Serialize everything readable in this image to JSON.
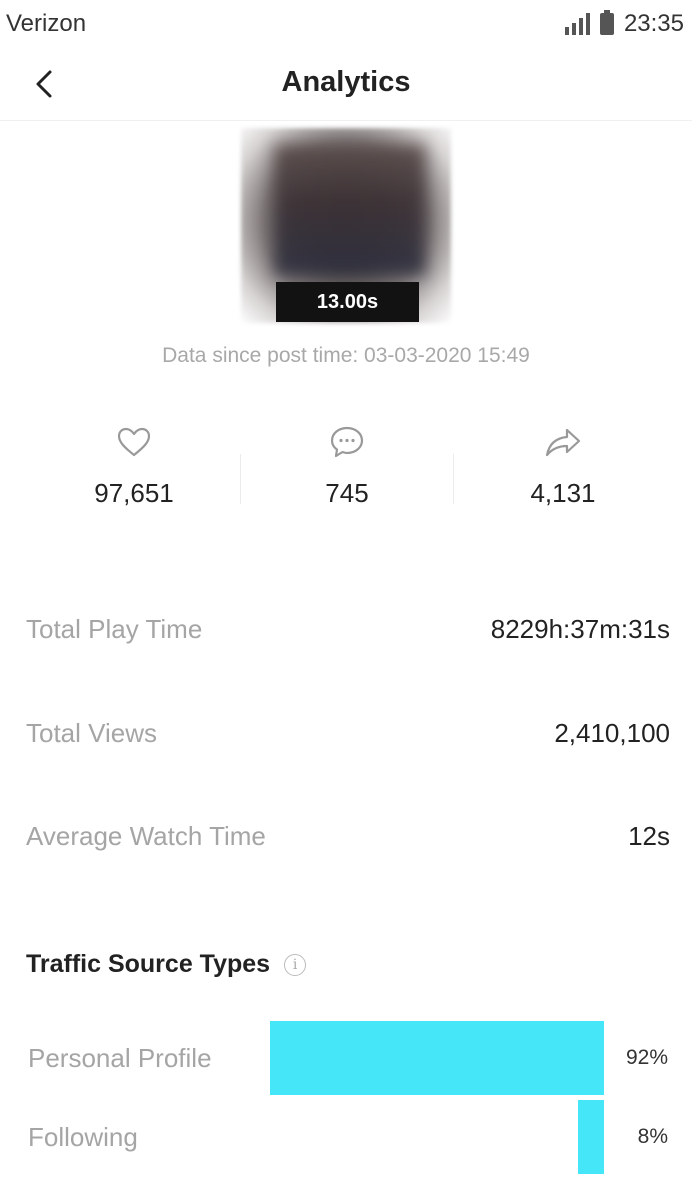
{
  "status_bar": {
    "carrier": "Verizon",
    "time": "23:35"
  },
  "header": {
    "title": "Analytics"
  },
  "video": {
    "duration": "13.00s"
  },
  "data_since": "Data since post time: 03-03-2020 15:49",
  "stats": [
    {
      "icon": "heart-icon",
      "value": "97,651"
    },
    {
      "icon": "comment-icon",
      "value": "745"
    },
    {
      "icon": "share-icon",
      "value": "4,131"
    }
  ],
  "metrics": [
    {
      "label": "Total Play Time",
      "value": "8229h:37m:31s"
    },
    {
      "label": "Total Views",
      "value": "2,410,100"
    },
    {
      "label": "Average Watch Time",
      "value": "12s"
    }
  ],
  "traffic": {
    "title": "Traffic Source Types",
    "bar_color": "#45e6f8",
    "sources": [
      {
        "label": "Personal Profile",
        "percent_text": "92%",
        "percent": 92
      },
      {
        "label": "Following",
        "percent_text": "8%",
        "percent": 8
      }
    ]
  }
}
